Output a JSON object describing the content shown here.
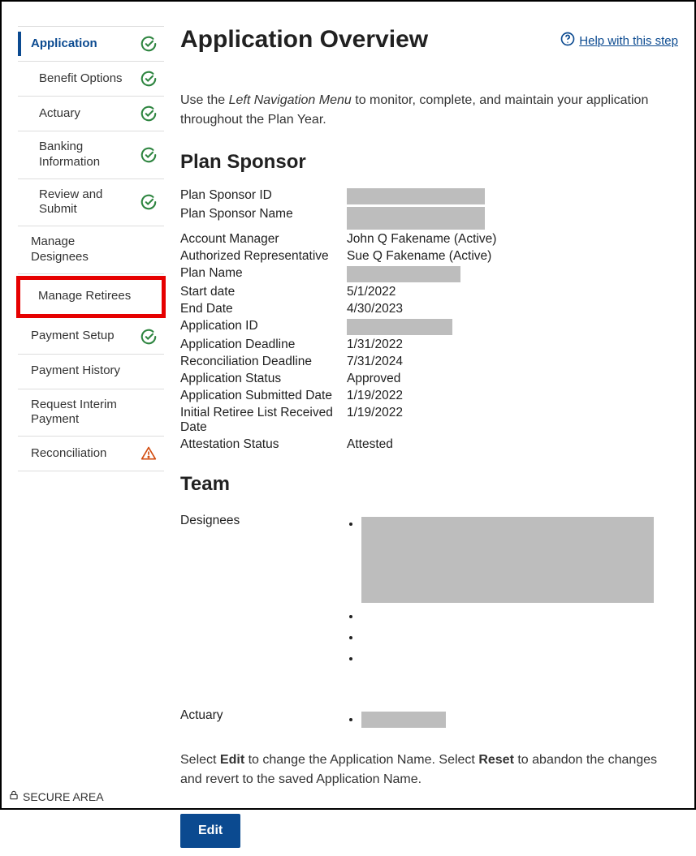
{
  "header": {
    "title": "Application Overview",
    "help_label": " Help with this step"
  },
  "intro": {
    "prefix": "Use the ",
    "em": "Left Navigation Menu",
    "suffix": " to monitor, complete, and maintain your application throughout the Plan Year."
  },
  "sidebar": {
    "items": [
      {
        "label": "Application",
        "icon": "check",
        "active": true,
        "top": true
      },
      {
        "label": "Benefit Options",
        "icon": "check"
      },
      {
        "label": "Actuary",
        "icon": "check"
      },
      {
        "label": "Banking Information",
        "icon": "check"
      },
      {
        "label": "Review and Submit",
        "icon": "check"
      },
      {
        "label": "Manage Designees",
        "icon": "",
        "top": true
      },
      {
        "label": "Manage Retirees",
        "icon": "",
        "top": true,
        "highlighted": true
      },
      {
        "label": "Payment Setup",
        "icon": "check",
        "top": true
      },
      {
        "label": "Payment History",
        "icon": "",
        "top": true
      },
      {
        "label": "Request Interim Payment",
        "icon": "",
        "top": true
      },
      {
        "label": "Reconciliation",
        "icon": "warn",
        "top": true
      }
    ]
  },
  "plan_sponsor": {
    "heading": "Plan Sponsor",
    "rows": [
      {
        "k": "Plan Sponsor ID",
        "redact": "w1"
      },
      {
        "k": "Plan Sponsor Name",
        "redact": "w2"
      },
      {
        "k": "Account Manager",
        "v": "John Q Fakename (Active)"
      },
      {
        "k": "Authorized Representative",
        "v": "Sue Q Fakename (Active)"
      },
      {
        "k": "Plan Name",
        "redact": "w3"
      },
      {
        "k": "Start date",
        "v": "5/1/2022"
      },
      {
        "k": "End Date",
        "v": "4/30/2023"
      },
      {
        "k": "Application ID",
        "redact": "w4"
      },
      {
        "k": "Application Deadline",
        "v": "1/31/2022"
      },
      {
        "k": "Reconciliation Deadline",
        "v": "7/31/2024"
      },
      {
        "k": "Application Status",
        "v": "Approved"
      },
      {
        "k": "Application Submitted Date",
        "v": "1/19/2022"
      },
      {
        "k": "Initial Retiree List Received Date",
        "v": "1/19/2022"
      },
      {
        "k": "Attestation Status",
        "v": "Attested"
      }
    ]
  },
  "team": {
    "heading": "Team",
    "designees_label": "Designees",
    "actuary_label": "Actuary"
  },
  "footer_note": {
    "p1": "Select ",
    "b1": "Edit",
    "p2": " to change the Application Name. Select ",
    "b2": "Reset",
    "p3": " to abandon the changes and revert to the saved Application Name."
  },
  "buttons": {
    "edit": "Edit"
  },
  "secure_label": "SECURE AREA"
}
